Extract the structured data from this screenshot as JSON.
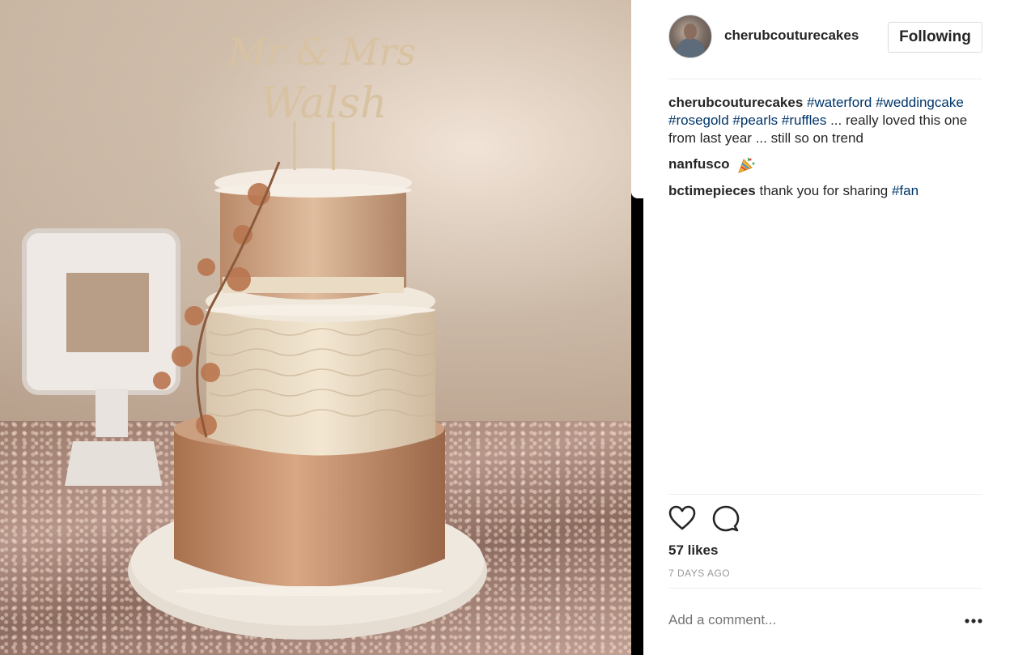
{
  "post": {
    "username": "cherubcouturecakes",
    "follow_label": "Following",
    "topper_text_line1": "Mr & Mrs",
    "topper_text_line2": "Walsh"
  },
  "comments": [
    {
      "author": "cherubcouturecakes",
      "parts": [
        {
          "text": "#waterford",
          "tag": true
        },
        {
          "text": " ",
          "tag": false
        },
        {
          "text": "#weddingcake",
          "tag": true
        },
        {
          "text": " ",
          "tag": false
        },
        {
          "text": "#rosegold",
          "tag": true
        },
        {
          "text": " ",
          "tag": false
        },
        {
          "text": "#pearls",
          "tag": true
        },
        {
          "text": " ",
          "tag": false
        },
        {
          "text": "#ruffles",
          "tag": true
        },
        {
          "text": " ... really loved this one from last year ... still so on trend",
          "tag": false
        }
      ]
    },
    {
      "author": "nanfusco",
      "parts": [],
      "emoji": "party-popper-icon"
    },
    {
      "author": "bctimepieces",
      "parts": [
        {
          "text": "thank you for sharing ",
          "tag": false
        },
        {
          "text": "#fan",
          "tag": true
        }
      ]
    }
  ],
  "footer": {
    "likes": "57 likes",
    "time": "7 DAYS AGO",
    "comment_placeholder": "Add a comment..."
  },
  "colors": {
    "text": "#262626",
    "hashtag": "#003569",
    "muted": "#999999",
    "border": "#dbdbdb"
  }
}
